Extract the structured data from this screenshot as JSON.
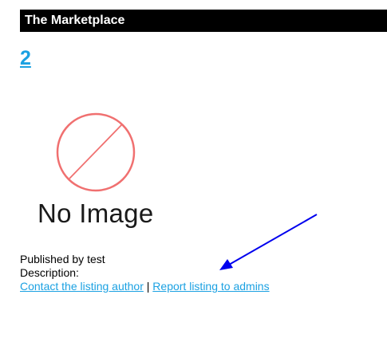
{
  "header": {
    "title": "The Marketplace"
  },
  "listing": {
    "title": "2",
    "image_placeholder_text": "No Image",
    "published_by_label": "Published by",
    "author": "test",
    "description_label": "Description:",
    "contact_link": "Contact the listing author",
    "separator": "|",
    "report_link": "Report listing to admins"
  },
  "colors": {
    "header_background": "#000000",
    "header_text": "#ffffff",
    "link": "#1ba1e2",
    "no_image_circle": "#f07070",
    "annotation_arrow": "#0000ee"
  },
  "icons": {
    "no_image": "no-image-icon",
    "arrow": "arrow-pointer-icon"
  }
}
